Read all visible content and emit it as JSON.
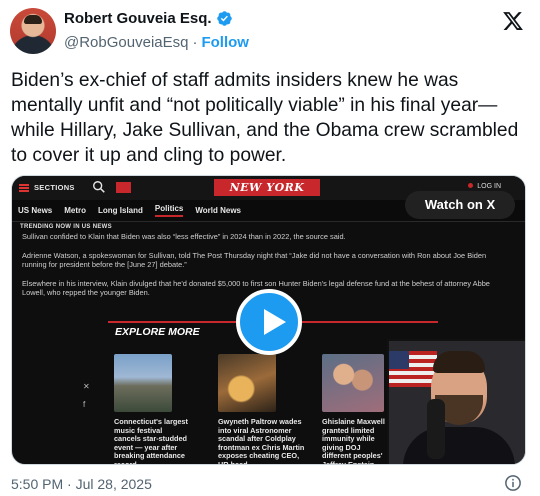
{
  "author": {
    "name": "Robert Gouveia Esq.",
    "handle": "@RobGouveiaEsq",
    "separator": "·",
    "follow_label": "Follow"
  },
  "tweet": {
    "text": "Biden’s ex-chief of staff admits insiders knew he was mentally unfit and “not politically viable” in his final year—while Hillary, Jake Sullivan, and the Obama crew scrambled to cover it up and cling to power."
  },
  "media": {
    "watch_label": "Watch on X",
    "newspaper": {
      "sections_label": "SECTIONS",
      "logo_text": "NEW YORK POST",
      "login_label": "LOG IN",
      "nav": [
        "US News",
        "Metro",
        "Long Island",
        "Politics",
        "World News"
      ],
      "nav_active": "Politics",
      "trending_label": "TRENDING NOW IN US NEWS",
      "paragraphs": [
        "Sullivan confided to Klain that Biden was also “less effective” in 2024 than in 2022, the source said.",
        "Adrienne Watson, a spokeswoman for Sullivan, told The Post Thursday night that “Jake did not have a conversation with Ron about Joe Biden running for president before the [June 27] debate.”",
        "Elsewhere in his interview, Klain divulged that he'd donated $5,000 to first son Hunter Biden's legal defense fund at the behest of attorney Abbe Lowell, who repped the younger Biden."
      ],
      "explore_label": "EXPLORE MORE",
      "cards": [
        "Connecticut's largest music festival cancels star-studded event — year after breaking attendance record",
        "Gwyneth Paltrow wades into viral Astronomer scandal after Coldplay frontman ex Chris Martin exposes cheating CEO, HR head",
        "Ghislaine Maxwell granted limited immunity while giving DOJ different peoples' Jeffrey Epstein"
      ]
    }
  },
  "footer": {
    "timestamp": "5:50 PM · Jul 28, 2025"
  },
  "colors": {
    "accent": "#1d9bf0",
    "nyp_red": "#c8272c",
    "text": "#0f1419",
    "muted": "#536471"
  },
  "icons": [
    "verified-badge-icon",
    "x-logo-icon",
    "play-icon",
    "info-icon",
    "search-icon",
    "mail-icon",
    "hamburger-icon"
  ]
}
